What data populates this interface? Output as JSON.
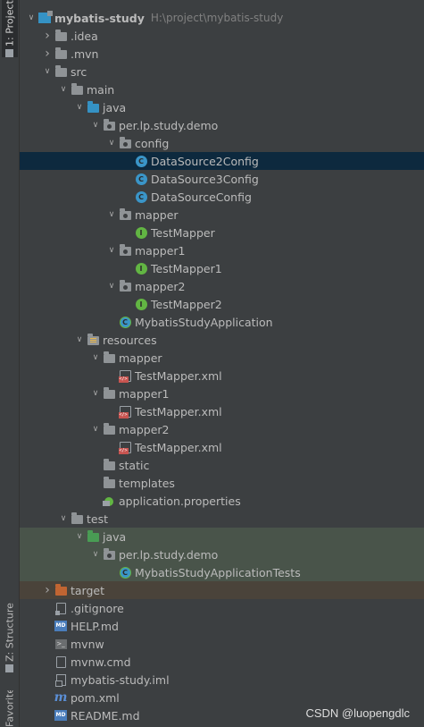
{
  "side_tabs": {
    "project": "1: Project",
    "structure": "Z: Structure",
    "favorites": "Favorites"
  },
  "tree": [
    {
      "label": "mybatis-study",
      "path": "H:\\project\\mybatis-study",
      "icon": "module-icon",
      "arrow": "open",
      "indent": 0,
      "bold": true
    },
    {
      "label": ".idea",
      "icon": "folder-icon",
      "arrow": "closed",
      "indent": 1
    },
    {
      "label": ".mvn",
      "icon": "folder-icon",
      "arrow": "closed",
      "indent": 1
    },
    {
      "label": "src",
      "icon": "folder-icon",
      "arrow": "open",
      "indent": 1
    },
    {
      "label": "main",
      "icon": "folder-icon",
      "arrow": "open",
      "indent": 2
    },
    {
      "label": "java",
      "icon": "source-folder-icon",
      "arrow": "open",
      "indent": 3
    },
    {
      "label": "per.lp.study.demo",
      "icon": "package-icon",
      "arrow": "open",
      "indent": 4
    },
    {
      "label": "config",
      "icon": "package-icon",
      "arrow": "open",
      "indent": 5
    },
    {
      "label": "DataSource2Config",
      "icon": "class-icon",
      "arrow": "none",
      "indent": 6,
      "selected": true
    },
    {
      "label": "DataSource3Config",
      "icon": "class-icon",
      "arrow": "none",
      "indent": 6
    },
    {
      "label": "DataSourceConfig",
      "icon": "class-icon",
      "arrow": "none",
      "indent": 6
    },
    {
      "label": "mapper",
      "icon": "package-icon",
      "arrow": "open",
      "indent": 5
    },
    {
      "label": "TestMapper",
      "icon": "interface-icon",
      "arrow": "none",
      "indent": 6
    },
    {
      "label": "mapper1",
      "icon": "package-icon",
      "arrow": "open",
      "indent": 5
    },
    {
      "label": "TestMapper1",
      "icon": "interface-icon",
      "arrow": "none",
      "indent": 6
    },
    {
      "label": "mapper2",
      "icon": "package-icon",
      "arrow": "open",
      "indent": 5
    },
    {
      "label": "TestMapper2",
      "icon": "interface-icon",
      "arrow": "none",
      "indent": 6
    },
    {
      "label": "MybatisStudyApplication",
      "icon": "spring-class-icon",
      "arrow": "none",
      "indent": 5
    },
    {
      "label": "resources",
      "icon": "resources-folder-icon",
      "arrow": "open",
      "indent": 3
    },
    {
      "label": "mapper",
      "icon": "folder-icon",
      "arrow": "open",
      "indent": 4
    },
    {
      "label": "TestMapper.xml",
      "icon": "xml-file-icon",
      "arrow": "none",
      "indent": 5
    },
    {
      "label": "mapper1",
      "icon": "folder-icon",
      "arrow": "open",
      "indent": 4
    },
    {
      "label": "TestMapper.xml",
      "icon": "xml-file-icon",
      "arrow": "none",
      "indent": 5
    },
    {
      "label": "mapper2",
      "icon": "folder-icon",
      "arrow": "open",
      "indent": 4
    },
    {
      "label": "TestMapper.xml",
      "icon": "xml-file-icon",
      "arrow": "none",
      "indent": 5
    },
    {
      "label": "static",
      "icon": "folder-icon",
      "arrow": "none",
      "indent": 4
    },
    {
      "label": "templates",
      "icon": "folder-icon",
      "arrow": "none",
      "indent": 4
    },
    {
      "label": "application.properties",
      "icon": "properties-file-icon",
      "arrow": "none",
      "indent": 4
    },
    {
      "label": "test",
      "icon": "folder-icon",
      "arrow": "open",
      "indent": 2
    },
    {
      "label": "java",
      "icon": "test-source-folder-icon",
      "arrow": "open",
      "indent": 3,
      "testbg": true
    },
    {
      "label": "per.lp.study.demo",
      "icon": "package-icon",
      "arrow": "open",
      "indent": 4,
      "testbg": true
    },
    {
      "label": "MybatisStudyApplicationTests",
      "icon": "spring-class-icon",
      "arrow": "none",
      "indent": 5,
      "testbg": true
    },
    {
      "label": "target",
      "icon": "excluded-folder-icon",
      "arrow": "closed",
      "indent": 1,
      "excluded": true
    },
    {
      "label": ".gitignore",
      "icon": "gitignore-file-icon",
      "arrow": "none",
      "indent": 1
    },
    {
      "label": "HELP.md",
      "icon": "markdown-file-icon",
      "arrow": "none",
      "indent": 1
    },
    {
      "label": "mvnw",
      "icon": "shell-file-icon",
      "arrow": "none",
      "indent": 1
    },
    {
      "label": "mvnw.cmd",
      "icon": "text-file-icon",
      "arrow": "none",
      "indent": 1
    },
    {
      "label": "mybatis-study.iml",
      "icon": "iml-file-icon",
      "arrow": "none",
      "indent": 1
    },
    {
      "label": "pom.xml",
      "icon": "maven-file-icon",
      "arrow": "none",
      "indent": 1
    },
    {
      "label": "README.md",
      "icon": "markdown-file-icon",
      "arrow": "none",
      "indent": 1
    }
  ],
  "watermark": "CSDN @luopengdlc",
  "colors": {
    "background": "#3c3f41",
    "selected_row": "#0d293e",
    "test_row": "#49544a",
    "excluded_row": "#4a433a",
    "class_icon": "#3a95c8",
    "interface_icon": "#62b543",
    "source_folder": "#3592c4",
    "test_folder": "#499c54",
    "excluded_folder": "#c16532"
  }
}
